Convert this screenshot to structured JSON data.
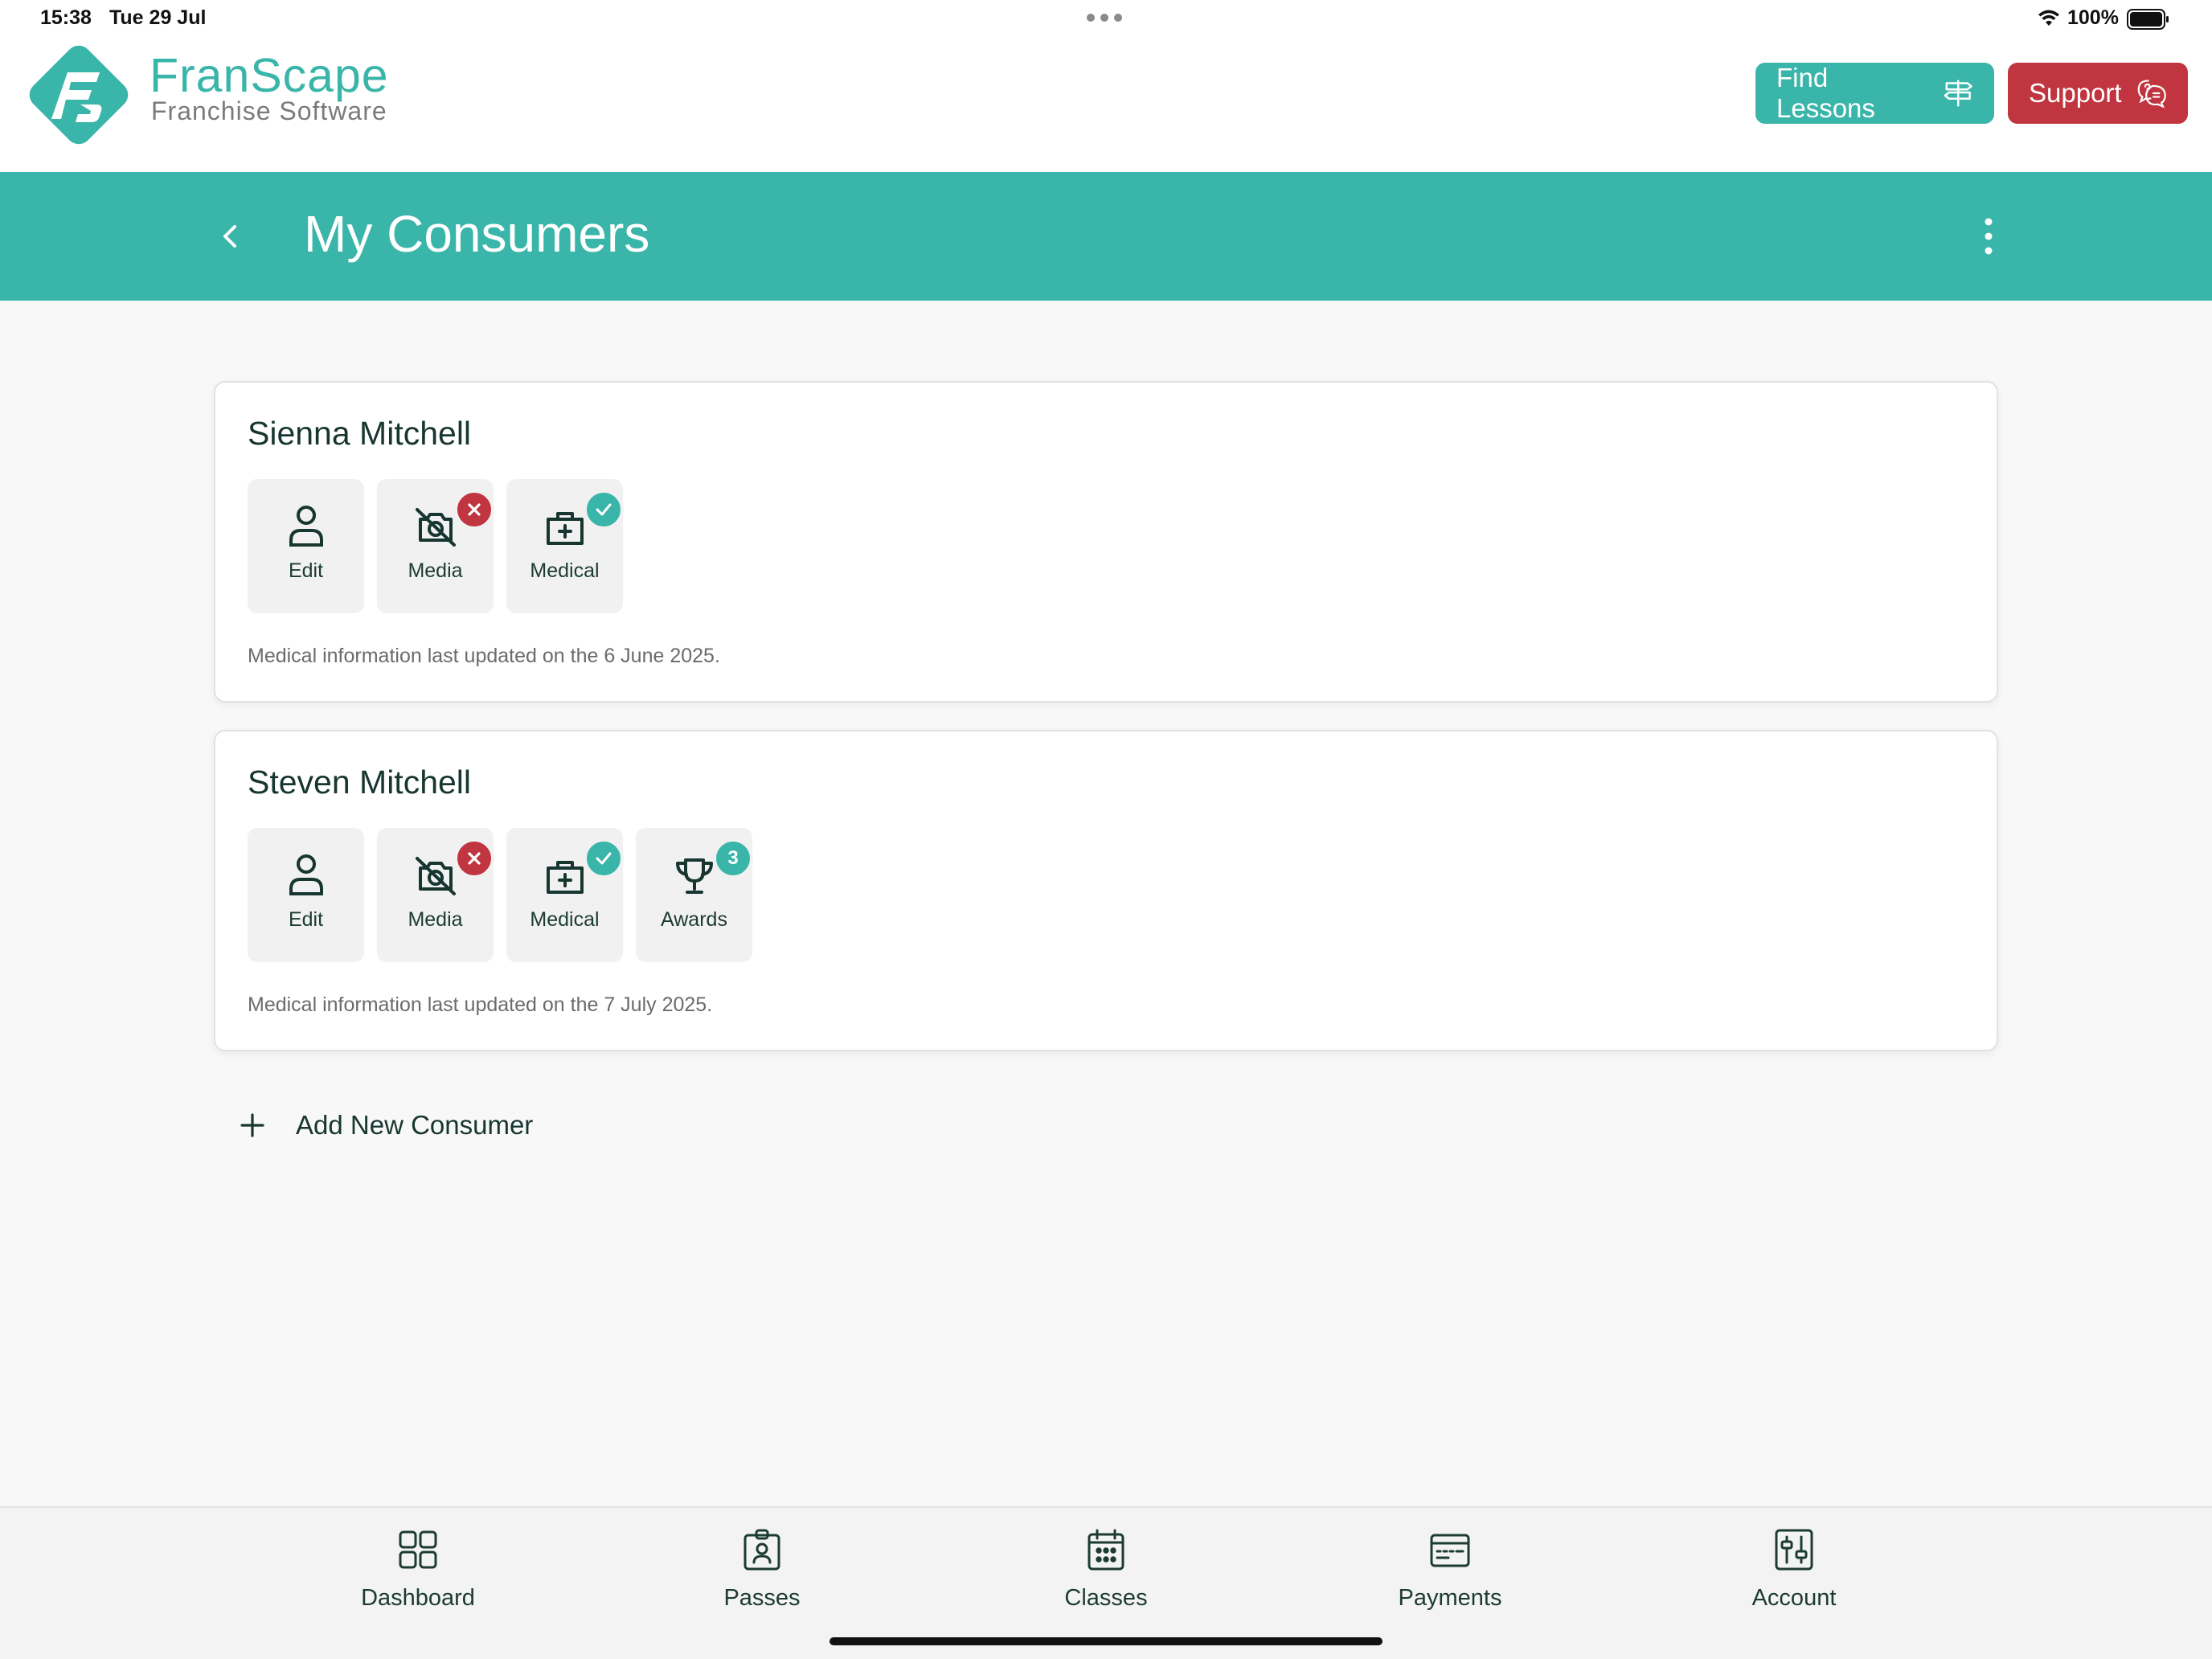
{
  "status_bar": {
    "time": "15:38",
    "date": "Tue 29 Jul",
    "battery": "100%"
  },
  "brand": {
    "name": "FranScape",
    "tagline": "Franchise Software",
    "accent": "#3ab5a9",
    "danger": "#c0353f"
  },
  "header": {
    "find_lessons_label": "Find Lessons",
    "support_label": "Support"
  },
  "titlebar": {
    "title": "My Consumers"
  },
  "consumers": [
    {
      "name": "Sienna Mitchell",
      "tiles": [
        {
          "label": "Edit",
          "icon": "user-icon"
        },
        {
          "label": "Media",
          "icon": "no-camera-icon",
          "badge": "x"
        },
        {
          "label": "Medical",
          "icon": "medical-kit-icon",
          "badge": "check"
        }
      ],
      "note": "Medical information last updated on the 6 June 2025."
    },
    {
      "name": "Steven Mitchell",
      "tiles": [
        {
          "label": "Edit",
          "icon": "user-icon"
        },
        {
          "label": "Media",
          "icon": "no-camera-icon",
          "badge": "x"
        },
        {
          "label": "Medical",
          "icon": "medical-kit-icon",
          "badge": "check"
        },
        {
          "label": "Awards",
          "icon": "trophy-icon",
          "badge": "3"
        }
      ],
      "note": "Medical information last updated on the 7 July 2025."
    }
  ],
  "add_consumer_label": "Add New Consumer",
  "tabs": [
    {
      "label": "Dashboard",
      "icon": "dashboard-icon"
    },
    {
      "label": "Passes",
      "icon": "pass-icon"
    },
    {
      "label": "Classes",
      "icon": "calendar-icon"
    },
    {
      "label": "Payments",
      "icon": "payment-card-icon"
    },
    {
      "label": "Account",
      "icon": "sliders-icon"
    }
  ]
}
